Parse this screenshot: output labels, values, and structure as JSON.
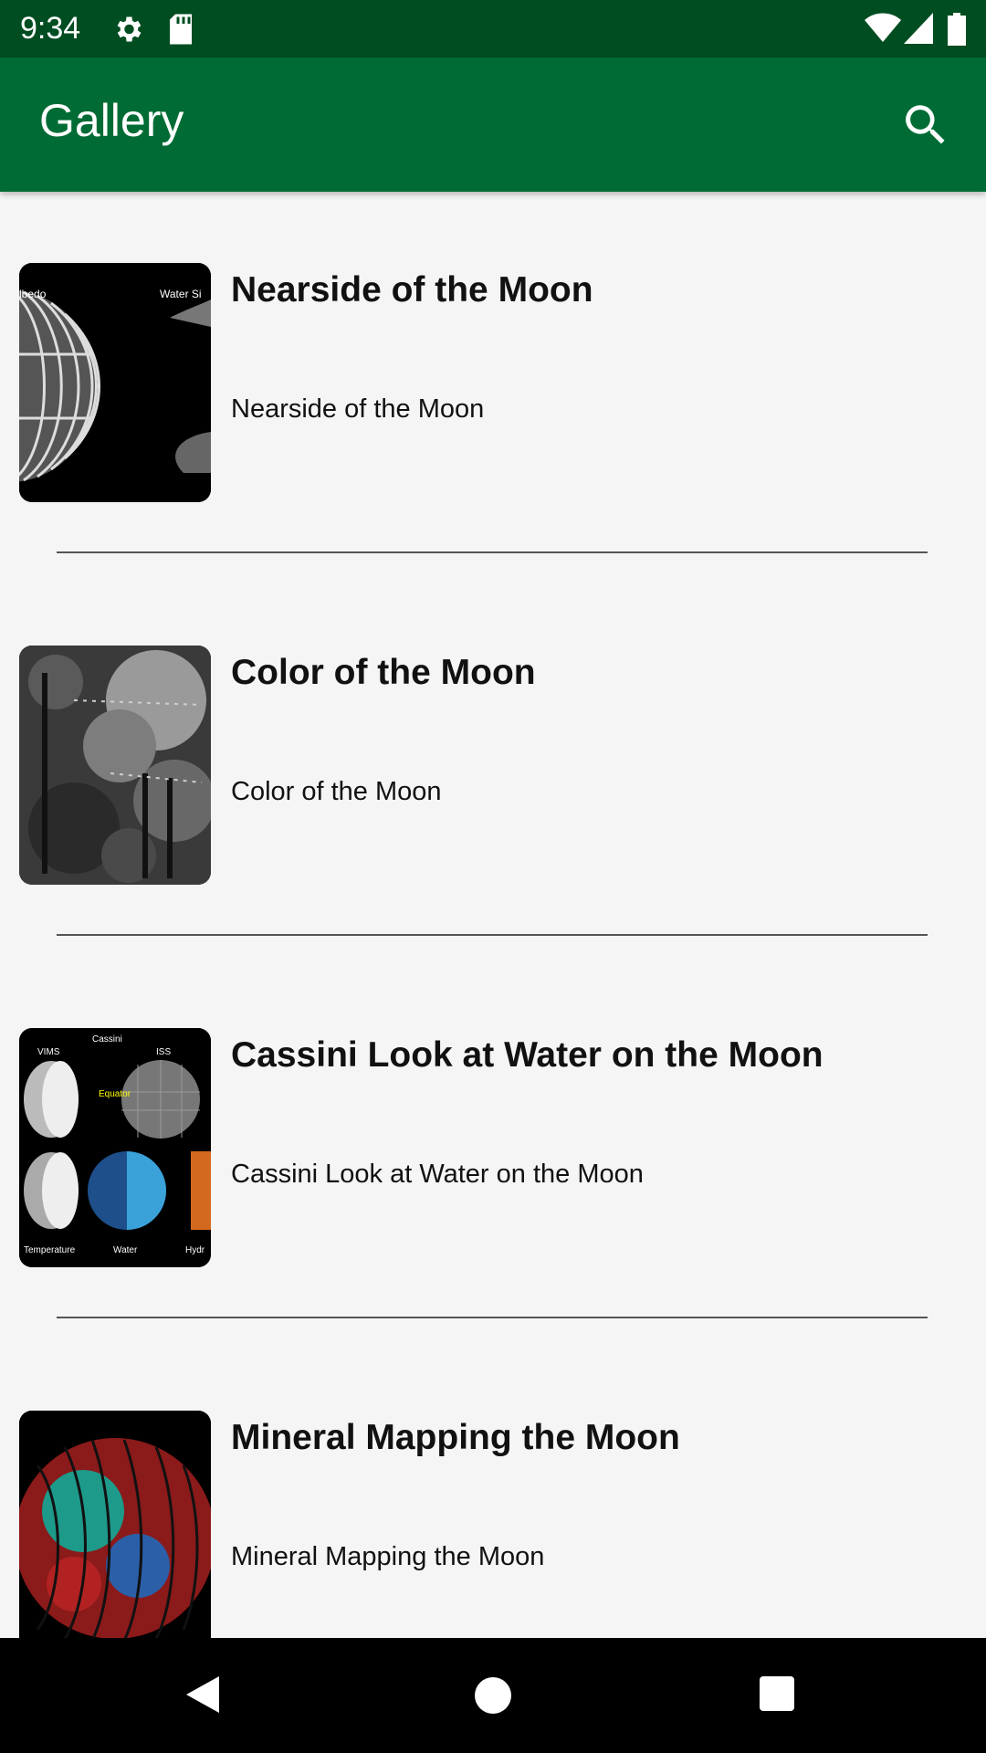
{
  "status_bar": {
    "time": "9:34",
    "icons": [
      "gear-icon",
      "sd-card-icon",
      "wifi-icon",
      "signal-icon",
      "battery-icon"
    ]
  },
  "app_bar": {
    "title": "Gallery",
    "search_icon": "search-icon"
  },
  "colors": {
    "status_bar": "#004d22",
    "app_bar": "#006b34",
    "background": "#f5f5f5"
  },
  "items": [
    {
      "title": "Nearside of the Moon",
      "subtitle": "Nearside of the Moon",
      "thumb_labels": [
        "lbedo",
        "Water Si"
      ]
    },
    {
      "title": "Color of the Moon",
      "subtitle": "Color of the Moon"
    },
    {
      "title": "Cassini Look at Water on the Moon",
      "subtitle": "Cassini Look at Water on the Moon",
      "thumb_labels": [
        "Cassini",
        "VIMS",
        "ISS",
        "Equator",
        "Temperature",
        "Water",
        "Hydr"
      ]
    },
    {
      "title": "Mineral Mapping the Moon",
      "subtitle": "Mineral Mapping the Moon"
    }
  ],
  "nav_bar": {
    "buttons": [
      "back-icon",
      "home-icon",
      "recents-icon"
    ]
  }
}
